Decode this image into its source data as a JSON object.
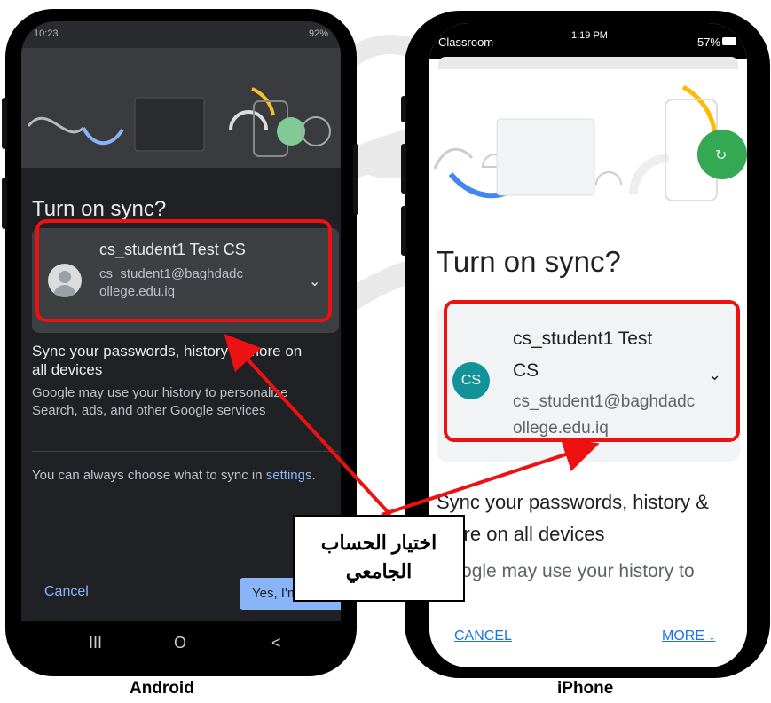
{
  "android": {
    "status": {
      "time": "10:23",
      "battery": "92%"
    },
    "title": "Turn on sync?",
    "account": {
      "name": "cs_student1 Test CS",
      "email": "cs_student1@baghdadcollege.edu.iq"
    },
    "sync_heading": "Sync your passwords, history & more on all devices",
    "sync_body": "Google may use your history to personalize Search, ads, and other Google services",
    "settings_text": "You can always choose what to sync in",
    "settings_link": "settings",
    "settings_suffix": ".",
    "cancel_label": "Cancel",
    "confirm_label": "Yes, I'm in",
    "nav": {
      "recents": "III",
      "home": "O",
      "back": "<"
    }
  },
  "iphone": {
    "status": {
      "app": "Classroom",
      "time": "1:19 PM",
      "battery": "57%"
    },
    "title": "Turn on sync?",
    "account": {
      "initials": "CS",
      "name": "cs_student1 Test CS",
      "email": "cs_student1@baghdadcollege.edu.iq"
    },
    "sync_heading": "Sync your passwords, history & more on all devices",
    "sync_body": "Google may use your history to",
    "cancel_label": "CANCEL",
    "more_label": "MORE ↓"
  },
  "callout": {
    "text": "اختيار الحساب الجامعي"
  },
  "captions": {
    "left": "Android",
    "right": "iPhone"
  },
  "colors": {
    "highlight": "#ee1111",
    "android_accent": "#8ab4f8",
    "iphone_accent": "#1a73e8",
    "avatar_teal": "#12939a",
    "sync_green": "#34a853"
  }
}
